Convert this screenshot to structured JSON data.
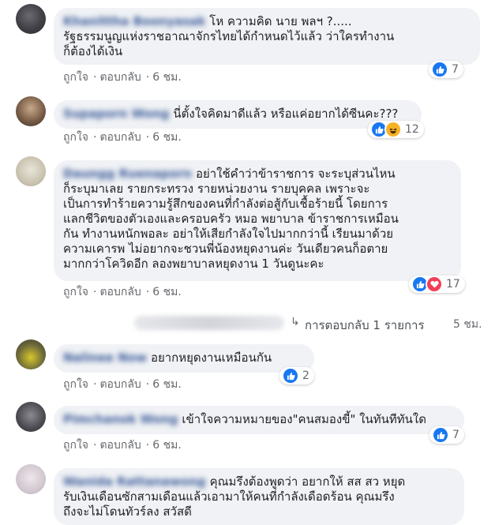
{
  "actions": {
    "like": "ถูกใจ",
    "reply": "ตอบกลับ",
    "separator": "·"
  },
  "comments": [
    {
      "name": "Khanittha Boonyasak",
      "text": "โห ความคิด นาย พลฯ ?.....\nรัฐธรรมนูญแห่งราชอาณาจักรไทยได้กำหนดไว้แล้ว ว่าใครทำงาน\nก็ต้องได้เงิน",
      "time": "6 ชม.",
      "reaction_count": "7",
      "reactions": [
        "like"
      ]
    },
    {
      "name": "Supaporn Wong",
      "text": "นี่ตั้งใจคิดมาดีแล้ว หรือแค่อยากได้ซีนคะ???",
      "time": "6 ชม.",
      "reaction_count": "12",
      "reactions": [
        "like",
        "haha"
      ]
    },
    {
      "name": "Daungg Ruenaporn",
      "text": "อย่าใช้คำว่าข้าราชการ จะระบุส่วนไหน\nก็ระบุมาเลย รายกระทรวง รายหน่วยงาน รายบุคคล เพราะจะ\nเป็นการทำร้ายความรู้สึกของคนที่กำลังต่อสู้กับเชื้อร้ายนี้ โดยการ\nแลกชีวิตของตัวเองและครอบครัว หมอ พยาบาล ข้าราชการเหมือน\nกัน ทำงานหนักพอละ อย่าให้เสียกำลังใจไปมากกว่านี้ เรียนมาด้วย\nความเคารพ ไม่อยากจะชวนพี่น้องหยุดงานค่ะ วันเดียวคนก็อตาย\nมากกว่าโควิดอีก ลองพยาบาลหยุดงาน 1 วันดูนะคะ",
      "time": "6 ชม.",
      "reaction_count": "17",
      "reactions": [
        "like",
        "love"
      ]
    },
    {
      "name": "Nalinee Now",
      "text": "อยากหยุดงานเหมือนกัน",
      "time": "6 ชม.",
      "reaction_count": "2",
      "reactions": [
        "like"
      ]
    },
    {
      "name": "Pimchanok Wong",
      "text": "เข้าใจความหมายของ\"คนสมองขี้\" ในทันทีทันใด",
      "time": "6 ชม.",
      "reaction_count": "7",
      "reactions": [
        "like"
      ]
    },
    {
      "name": "Wanida Rattanawong",
      "text": "คุณมรึงต้องพูดว่า อยากให้ สส สว หยุด\nรับเงินเดือนซักสามเดือนแล้วเอามาให้คนที่กำลังเดือดร้อน คุณมรึง\nถึงจะไม่โดนทัวร์ลง สวัสดี",
      "time": "",
      "reaction_count": "",
      "reactions": []
    }
  ],
  "reply_summary": {
    "label": "การตอบกลับ 1 รายการ",
    "time": "5 ชม.",
    "arrow": "↳"
  },
  "colors": {
    "bubble": "#f0f2f5",
    "name": "#385898",
    "meta": "#65676b",
    "like": "#1877f2",
    "love": "#f33e58",
    "haha": "#f7b125"
  }
}
